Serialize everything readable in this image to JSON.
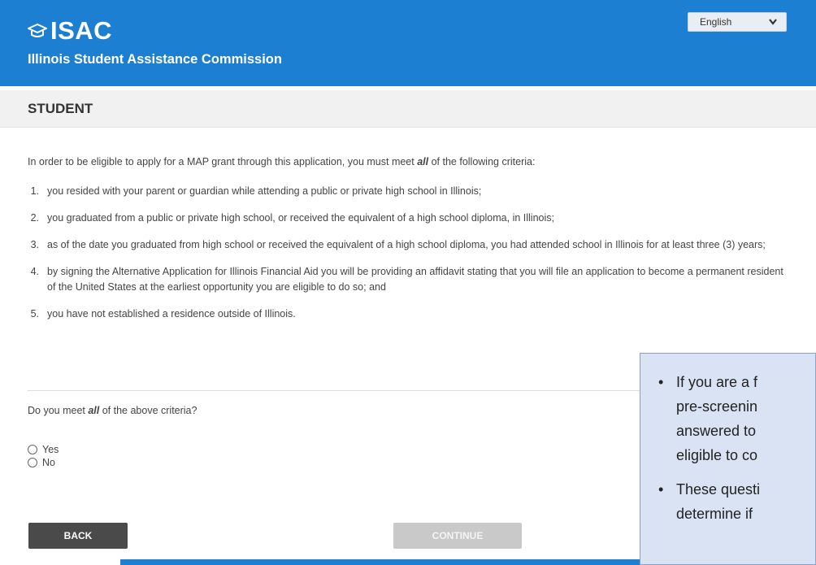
{
  "header": {
    "logo_text": "ISAC",
    "org_name": "Illinois Student Assistance Commission",
    "language": {
      "selected": "English"
    },
    "colors": {
      "brand_blue": "#1c7fd1"
    }
  },
  "section": {
    "title": "STUDENT"
  },
  "content": {
    "intro_pre": "In order to be eligible to apply for a MAP grant through this application, you must meet ",
    "intro_emph": "all",
    "intro_post": " of the following criteria:",
    "criteria": [
      {
        "num": "1.",
        "text": "you resided with your parent or guardian while attending a public or private high school in Illinois;"
      },
      {
        "num": "2.",
        "text": "you graduated from a public or private high school, or received the equivalent of a high school diploma, in Illinois;"
      },
      {
        "num": "3.",
        "text": "as of the date you graduated from high school or received the equivalent of a high school diploma, you had attended school in Illinois for at least three (3) years;"
      },
      {
        "num": "4.",
        "text": "by signing the Alternative Application for Illinois Financial Aid you will be providing an affidavit stating that you will file an application to become a permanent resident of the United States at the earliest opportunity you are eligible to do so; and"
      },
      {
        "num": "5.",
        "text": "you have not established a residence outside of Illinois."
      }
    ],
    "question_pre": "Do you meet ",
    "question_emph": "all",
    "question_post": " of the above criteria?",
    "options": [
      {
        "label": "Yes"
      },
      {
        "label": "No"
      }
    ]
  },
  "buttons": {
    "back": "BACK",
    "continue": "CONTINUE"
  },
  "callout": {
    "bullet": "•",
    "items": [
      {
        "lines": [
          "If you are a f",
          "pre-screenin",
          "answered to",
          "eligible to co"
        ]
      },
      {
        "lines": [
          "These questi",
          "determine if"
        ]
      }
    ]
  }
}
